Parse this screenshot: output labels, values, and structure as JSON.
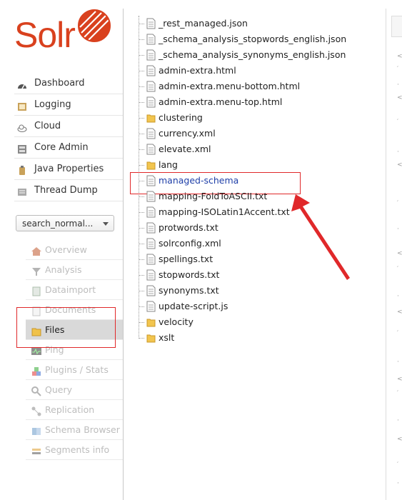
{
  "logo": {
    "text": "Solr",
    "accent": "#d9411e"
  },
  "main_nav": [
    {
      "label": "Dashboard",
      "icon": "dashboard-icon"
    },
    {
      "label": "Logging",
      "icon": "logging-icon"
    },
    {
      "label": "Cloud",
      "icon": "cloud-icon"
    },
    {
      "label": "Core Admin",
      "icon": "core-admin-icon"
    },
    {
      "label": "Java Properties",
      "icon": "java-properties-icon"
    },
    {
      "label": "Thread Dump",
      "icon": "thread-dump-icon"
    }
  ],
  "core_selector": {
    "value": "search_normal..."
  },
  "core_nav": [
    {
      "label": "Overview",
      "icon": "home-icon"
    },
    {
      "label": "Analysis",
      "icon": "funnel-icon"
    },
    {
      "label": "Dataimport",
      "icon": "dataimport-icon"
    },
    {
      "label": "Documents",
      "icon": "documents-icon"
    },
    {
      "label": "Files",
      "icon": "folder-icon",
      "active": true
    },
    {
      "label": "Ping",
      "icon": "ping-icon"
    },
    {
      "label": "Plugins / Stats",
      "icon": "plugins-icon"
    },
    {
      "label": "Query",
      "icon": "query-icon"
    },
    {
      "label": "Replication",
      "icon": "replication-icon"
    },
    {
      "label": "Schema Browser",
      "icon": "schema-browser-icon"
    },
    {
      "label": "Segments info",
      "icon": "segments-icon"
    }
  ],
  "files": [
    {
      "name": "_rest_managed.json",
      "type": "file"
    },
    {
      "name": "_schema_analysis_stopwords_english.json",
      "type": "file"
    },
    {
      "name": "_schema_analysis_synonyms_english.json",
      "type": "file"
    },
    {
      "name": "admin-extra.html",
      "type": "file"
    },
    {
      "name": "admin-extra.menu-bottom.html",
      "type": "file"
    },
    {
      "name": "admin-extra.menu-top.html",
      "type": "file"
    },
    {
      "name": "clustering",
      "type": "folder"
    },
    {
      "name": "currency.xml",
      "type": "file"
    },
    {
      "name": "elevate.xml",
      "type": "file"
    },
    {
      "name": "lang",
      "type": "folder"
    },
    {
      "name": "managed-schema",
      "type": "file",
      "selected": true
    },
    {
      "name": "mapping-FoldToASCII.txt",
      "type": "file"
    },
    {
      "name": "mapping-ISOLatin1Accent.txt",
      "type": "file"
    },
    {
      "name": "protwords.txt",
      "type": "file"
    },
    {
      "name": "solrconfig.xml",
      "type": "file"
    },
    {
      "name": "spellings.txt",
      "type": "file"
    },
    {
      "name": "stopwords.txt",
      "type": "file"
    },
    {
      "name": "synonyms.txt",
      "type": "file"
    },
    {
      "name": "update-script.js",
      "type": "file"
    },
    {
      "name": "velocity",
      "type": "folder"
    },
    {
      "name": "xslt",
      "type": "folder"
    }
  ],
  "colors": {
    "highlight": "#e0282a",
    "selected_link": "#1f3fa8",
    "active_bg": "#d9d9d9"
  }
}
